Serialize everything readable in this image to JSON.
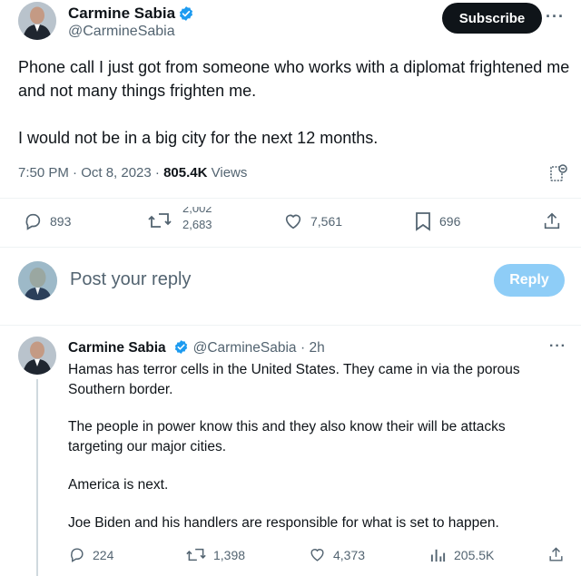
{
  "main_tweet": {
    "author_name": "Carmine Sabia",
    "author_handle": "@CarmineSabia",
    "subscribe_label": "Subscribe",
    "more_label": "···",
    "text_p1": "Phone call I just got from someone who works with a diplomat frightened me and not many things frighten me.",
    "text_p2": "I would not be in a big city for the next 12 months.",
    "timestamp": "7:50 PM · Oct 8, 2023 ·",
    "views_count": "805.4K",
    "views_label": "Views",
    "actions": {
      "replies": "893",
      "reposts_top": "2,002",
      "reposts_bottom": "2,683",
      "likes": "7,561",
      "bookmarks": "696"
    }
  },
  "reply_box": {
    "placeholder": "Post your reply",
    "button_label": "Reply"
  },
  "reply_tweet": {
    "author_name": "Carmine Sabia",
    "author_handle": "@CarmineSabia",
    "time": "· 2h",
    "more_label": "···",
    "p1": "Hamas has terror cells in the United States. They came in via the porous Southern border.",
    "p2": "The people in power know this and they also know their will be attacks targeting our major cities.",
    "p3": "America is next.",
    "p4": "Joe Biden and his handlers are responsible for what is set to happen.",
    "actions": {
      "replies": "224",
      "reposts": "1,398",
      "likes": "4,373",
      "views": "205.5K"
    }
  },
  "colors": {
    "verified": "#1d9bf0",
    "reply_button": "#8ecdf7",
    "subscribe_button": "#0f1419"
  }
}
